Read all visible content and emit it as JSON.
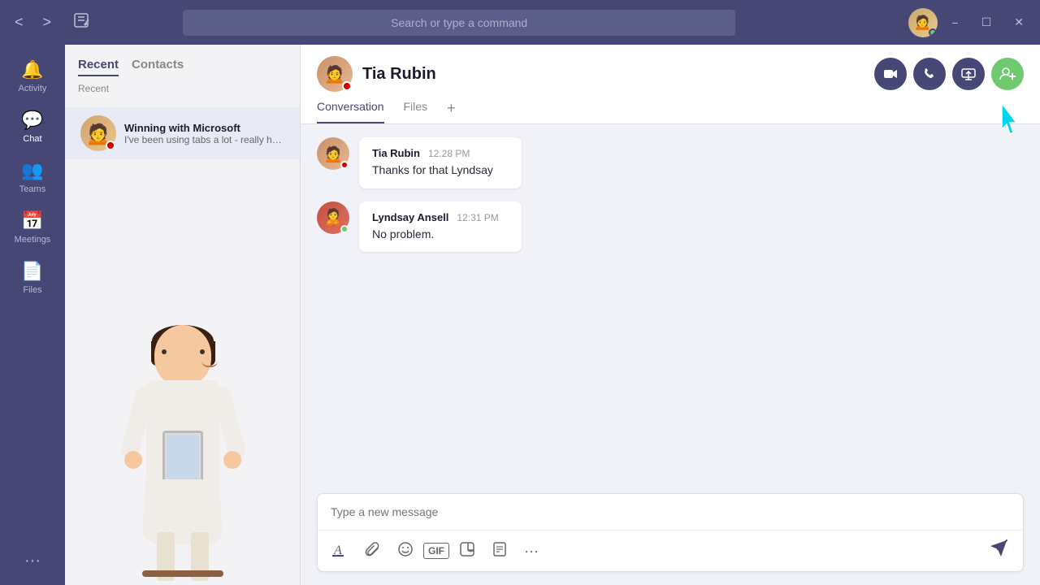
{
  "titlebar": {
    "search_placeholder": "Search or type a command",
    "window_buttons": {
      "minimize": "−",
      "maximize": "☐",
      "close": "✕"
    }
  },
  "sidebar": {
    "items": [
      {
        "id": "activity",
        "label": "Activity",
        "icon": "🔔"
      },
      {
        "id": "chat",
        "label": "Chat",
        "icon": "💬"
      },
      {
        "id": "teams",
        "label": "Teams",
        "icon": "👥"
      },
      {
        "id": "meetings",
        "label": "Meetings",
        "icon": "📅"
      },
      {
        "id": "files",
        "label": "Files",
        "icon": "📄"
      }
    ],
    "more": "..."
  },
  "chat_list": {
    "tabs": [
      "Recent",
      "Contacts"
    ],
    "active_tab": "Recent",
    "filter_label": "Recent",
    "items": [
      {
        "name": "Winning with Microsoft",
        "preview": "I've been using tabs a lot - really handy.",
        "status": "busy"
      }
    ]
  },
  "conversation": {
    "user": {
      "name": "Tia Rubin",
      "status": "busy"
    },
    "tabs": [
      "Conversation",
      "Files"
    ],
    "active_tab": "Conversation",
    "messages": [
      {
        "sender": "Tia Rubin",
        "time": "12.28 PM",
        "text": "Thanks for that Lyndsay",
        "status": "busy"
      },
      {
        "sender": "Lyndsay Ansell",
        "time": "12:31 PM",
        "text": "No problem.",
        "status": "available"
      }
    ],
    "input_placeholder": "Type a new message",
    "action_buttons": [
      "video-call",
      "audio-call",
      "share-screen",
      "add-people"
    ]
  }
}
